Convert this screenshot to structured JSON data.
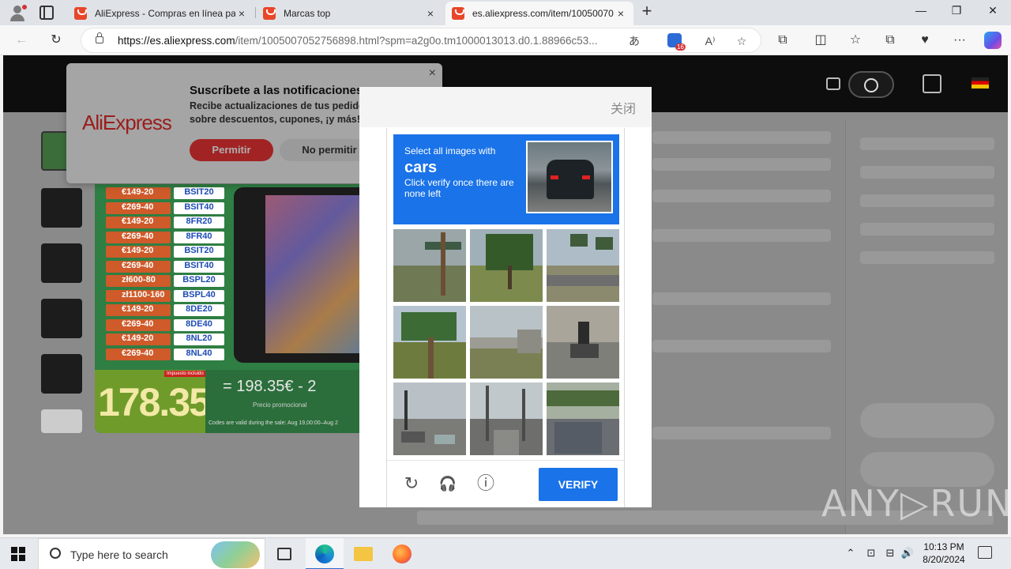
{
  "browser": {
    "tabs": [
      {
        "title": "AliExpress - Compras en línea pa",
        "active": false
      },
      {
        "title": "Marcas top",
        "active": false
      },
      {
        "title": "es.aliexpress.com/item/10050070",
        "active": true
      }
    ],
    "tab_close_glyph": "×",
    "new_tab_glyph": "+",
    "window_controls": {
      "minimize": "—",
      "maximize": "❐",
      "close": "✕"
    },
    "url_host": "https://es.aliexpress.com",
    "url_path": "/item/1005007052756898.html?spm=a2g0o.tm1000013013.d0.1.88966c53...",
    "address_icons": {
      "translate": "あ",
      "read_aloud": "A⁾",
      "favorite": "☆"
    },
    "extension_badge": "16",
    "toolbar_icons": {
      "back": "←",
      "refresh": "↻",
      "extensions": "⧉",
      "split": "◫",
      "favorites": "☆",
      "collections": "⧉",
      "performance": "♥",
      "more": "···"
    }
  },
  "notification_prompt": {
    "logo": "AliExpress",
    "title": "Suscríbete a las notificaciones",
    "body": "Recibe actualizaciones de tus pedidos sobre descuentos, cupones, ¡y más!",
    "allow_label": "Permitir",
    "deny_label": "No permitir",
    "close_glyph": "×"
  },
  "promo": {
    "coupons": [
      {
        "amount": "€149-20",
        "code": "BSIT20"
      },
      {
        "amount": "€269-40",
        "code": "BSIT40"
      },
      {
        "amount": "€149-20",
        "code": "8FR20"
      },
      {
        "amount": "€269-40",
        "code": "8FR40"
      },
      {
        "amount": "€149-20",
        "code": "BSIT20"
      },
      {
        "amount": "€269-40",
        "code": "BSIT40"
      },
      {
        "amount": "zł600-80",
        "code": "BSPL20"
      },
      {
        "amount": "zł1100-160",
        "code": "BSPL40"
      },
      {
        "amount": "€149-20",
        "code": "8DE20"
      },
      {
        "amount": "€269-40",
        "code": "8DE40"
      },
      {
        "amount": "€149-20",
        "code": "8NL20"
      },
      {
        "amount": "€269-40",
        "code": "8NL40"
      }
    ],
    "big_price": "178.35€",
    "tax_badge": "Impuesto incluido",
    "equals_price": "= 198.35€   -  2",
    "promo_label": "Precio promocional",
    "footnote": "Codes are valid during the sale: Aug 19,00:00–Aug 2"
  },
  "captcha_modal": {
    "close_label": "关闭",
    "instruction_line1": "Select all images with",
    "target": "cars",
    "instruction_line2": "Click verify once there are none left",
    "tiles": [
      {
        "scene": "palm-building"
      },
      {
        "scene": "tree-road"
      },
      {
        "scene": "palms-street"
      },
      {
        "scene": "palm-close"
      },
      {
        "scene": "highway-bridge"
      },
      {
        "scene": "cyclist"
      },
      {
        "scene": "intersection-cars"
      },
      {
        "scene": "street-poles"
      },
      {
        "scene": "road-parking"
      }
    ],
    "footer_icons": {
      "reload": "↻",
      "audio": "🎧",
      "info": "ⓘ"
    },
    "verify_label": "VERIFY"
  },
  "watermark": "ANY▷RUN",
  "taskbar": {
    "search_placeholder": "Type here to search",
    "time": "10:13 PM",
    "date": "8/20/2024",
    "tray_icons": {
      "chevron": "⌃",
      "network": "⊡",
      "speaker": "🔊",
      "wifi": "⊟"
    }
  },
  "colors": {
    "accent": "#1a73e8",
    "aliexpress_red": "#e22c2c",
    "taskbar_active": "#2b6ccf"
  }
}
